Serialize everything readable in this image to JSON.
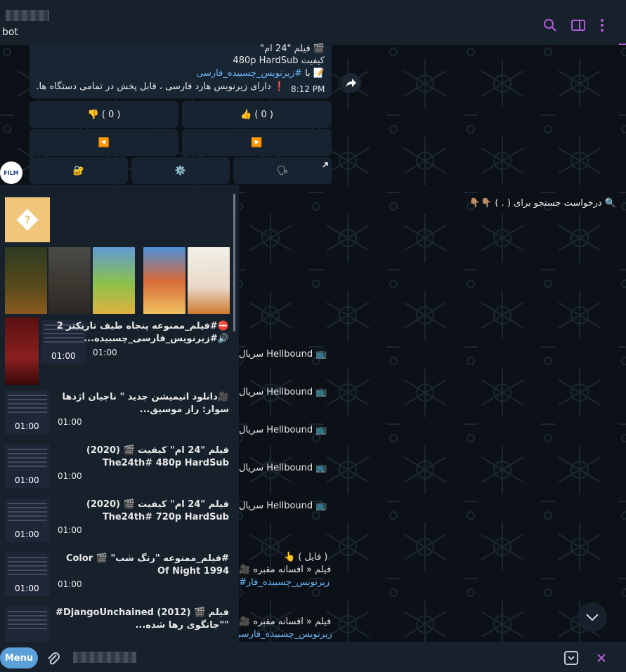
{
  "header": {
    "subtitle": "bot"
  },
  "message": {
    "line1": "🎬 فیلم \"24 ام\"",
    "line2": "کیفیت 480p HardSub",
    "line3_prefix": "📝 با ",
    "line3_tag": "#زیرنویس_چسبیده_فارسی",
    "line4": "❗️ دارای زیرنویس هارد فارسی ، قابل پخش در تمامی دستگاه ها.",
    "time": "8:12 PM"
  },
  "keyboard": {
    "dislike": "👎 ( 0 )",
    "like": "👍 ( 0 )",
    "prev": "◀️",
    "next": "▶️",
    "lock": "🔐",
    "settings": "⚙️",
    "speech": "🗣"
  },
  "avatar_label": "FILM",
  "inline": {
    "request_title": "🔍 درخواست جستجو برای ( . ) 👇🏽👇🏽",
    "results": [
      {
        "title": "⛔️#فیلم_ممنوعه پنجاه طیف تاریکتر 2 🔊#زیرنویس_فارسی_چسبیده...",
        "duration": "01:00",
        "time": "01:00"
      },
      {
        "title": "🎥دانلود انیمیشن جدید \" ناجیان اژدها سوار: راز موسیق...",
        "duration": "01:00",
        "time": "01:00"
      },
      {
        "title": "فیلم \"24 ام\"  کیفیت 🎬 (2020) The24th# 480p HardSub",
        "duration": "01:00",
        "time": "01:00"
      },
      {
        "title": "فیلم \"24 ام\"  کیفیت 🎬 (2020) The24th# 720p HardSub",
        "duration": "01:00",
        "time": "01:00"
      },
      {
        "title": "#فیلم_ممنوعه  \"رنگ شب\" 🎬 Color Of Night 1994",
        "duration": "01:00",
        "time": "01:00"
      },
      {
        "title": "فیلم 🎬 (2012) DjangoUnchained# \"\"جانگوی رها شده...",
        "duration": "",
        "time": ""
      }
    ]
  },
  "side_lines": [
    "سریال Hellbound 📺",
    "سریال Hellbound 📺",
    "سریال Hellbound 📺",
    "سریال Hellbound 📺",
    "سریال Hellbound 📺",
    "👆 ( فایل )",
    "🎥 فیلم « افسانه مقبره",
    "#زیرنویس_چسبیده_فار",
    "🎥 فیلم « افسانه مقبره",
    "#زیرنویس_چسبیده_فارسی"
  ],
  "bottom": {
    "menu_label": "Menu"
  },
  "colors": {
    "accent": "#b25bd6",
    "link": "#6ab2f2",
    "menu": "#5ca0d9"
  }
}
